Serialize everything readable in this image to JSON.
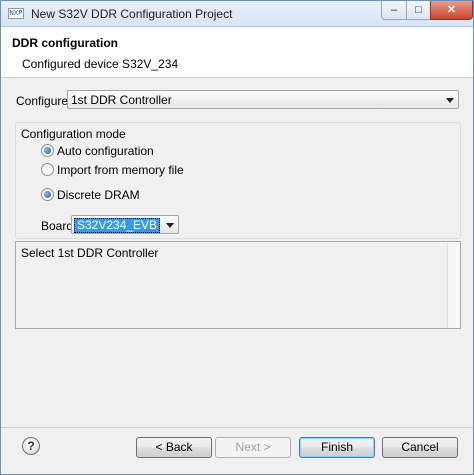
{
  "window": {
    "title": "New S32V DDR Configuration Project",
    "icon_text": "NXP",
    "controls": {
      "minimize": "–",
      "maximize": "□",
      "close": "✕"
    }
  },
  "header": {
    "title": "DDR configuration",
    "subtitle": "Configured device S32V_234"
  },
  "configure": {
    "label": "Configure:",
    "selected": "1st DDR Controller"
  },
  "mode": {
    "label": "Configuration mode",
    "options": [
      {
        "label": "Auto configuration",
        "checked": true
      },
      {
        "label": "Import from memory file",
        "checked": false
      }
    ]
  },
  "dram": {
    "options": [
      {
        "label": "Discrete DRAM",
        "checked": true
      }
    ]
  },
  "board": {
    "label": "Board",
    "selected": "S32V234_EVB"
  },
  "description": {
    "text": "Select 1st DDR Controller"
  },
  "footer": {
    "help_label": "?",
    "back_label": "< Back",
    "next_label": "Next >",
    "finish_label": "Finish",
    "cancel_label": "Cancel"
  }
}
